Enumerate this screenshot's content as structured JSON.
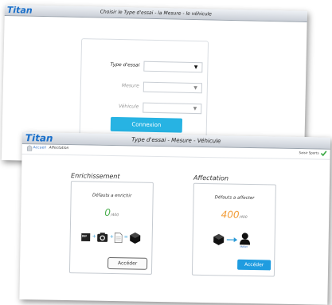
{
  "app_name": "Titan",
  "login_window": {
    "title": "Choisir le Type d'essai - la Mesure - le véhicule",
    "fields": [
      {
        "label": "Type d'essai",
        "value": ""
      },
      {
        "label": "Mesure",
        "value": ""
      },
      {
        "label": "Véhicule",
        "value": ""
      }
    ],
    "connect_label": "Connexion"
  },
  "main_window": {
    "title": "Type d'essai - Mesure - Véhicule",
    "breadcrumb": {
      "home": "Accueil",
      "current": "Affectation"
    },
    "user": "Saisir Sports",
    "enrichissement": {
      "title": "Enrichissement",
      "subtitle": "Défauts a enrichir",
      "count": "0",
      "total": "/400",
      "count_color": "#4caf50",
      "icon_labels": {
        "box": "DEF"
      },
      "button": "Accéder"
    },
    "affectation": {
      "title": "Affectation",
      "subtitle": "Défauts a affecter",
      "count": "400",
      "total": "/400",
      "count_color": "#f29d38",
      "icon_labels": {
        "user": "Métier"
      },
      "button": "Accéder"
    }
  },
  "colors": {
    "brand": "#1a6fc9",
    "accent_blue": "#27b3e3",
    "success": "#4caf50"
  }
}
